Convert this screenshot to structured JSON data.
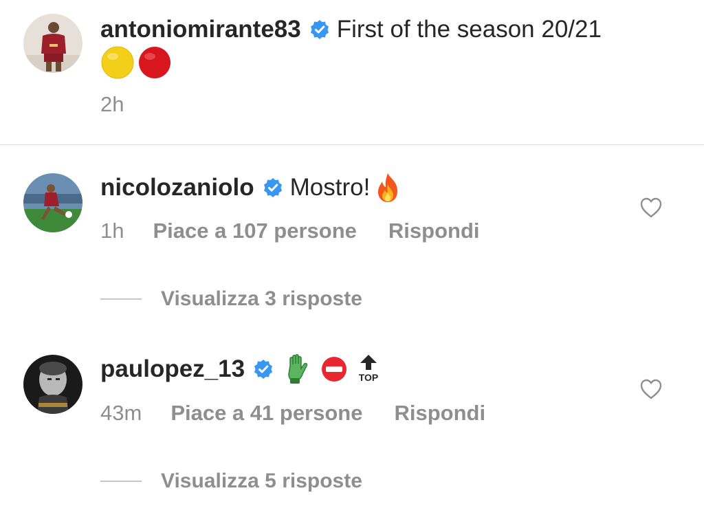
{
  "post": {
    "username": "antoniomirante83",
    "caption": "First of the season 20/21",
    "caption_emojis": [
      "yellow-circle-icon",
      "red-circle-icon"
    ],
    "time": "2h"
  },
  "comments": [
    {
      "username": "nicolozaniolo",
      "text": "Mostro!",
      "emoji": "fire-icon",
      "time": "1h",
      "likes_label": "Piace a 107 persone",
      "reply_label": "Rispondi",
      "view_replies_label": "Visualizza 3 risposte"
    },
    {
      "username": "paulopez_13",
      "text": "",
      "emojis": [
        "gloves-icon",
        "no-entry-icon",
        "top-arrow-icon"
      ],
      "top_arrow_text": "TOP",
      "time": "43m",
      "likes_label": "Piace a 41 persone",
      "reply_label": "Rispondi",
      "view_replies_label": "Visualizza 5 risposte"
    }
  ],
  "colors": {
    "verified": "#3897f0",
    "muted_text": "#8e8e8e",
    "primary_text": "#262626",
    "divider": "#dbdbdb"
  }
}
